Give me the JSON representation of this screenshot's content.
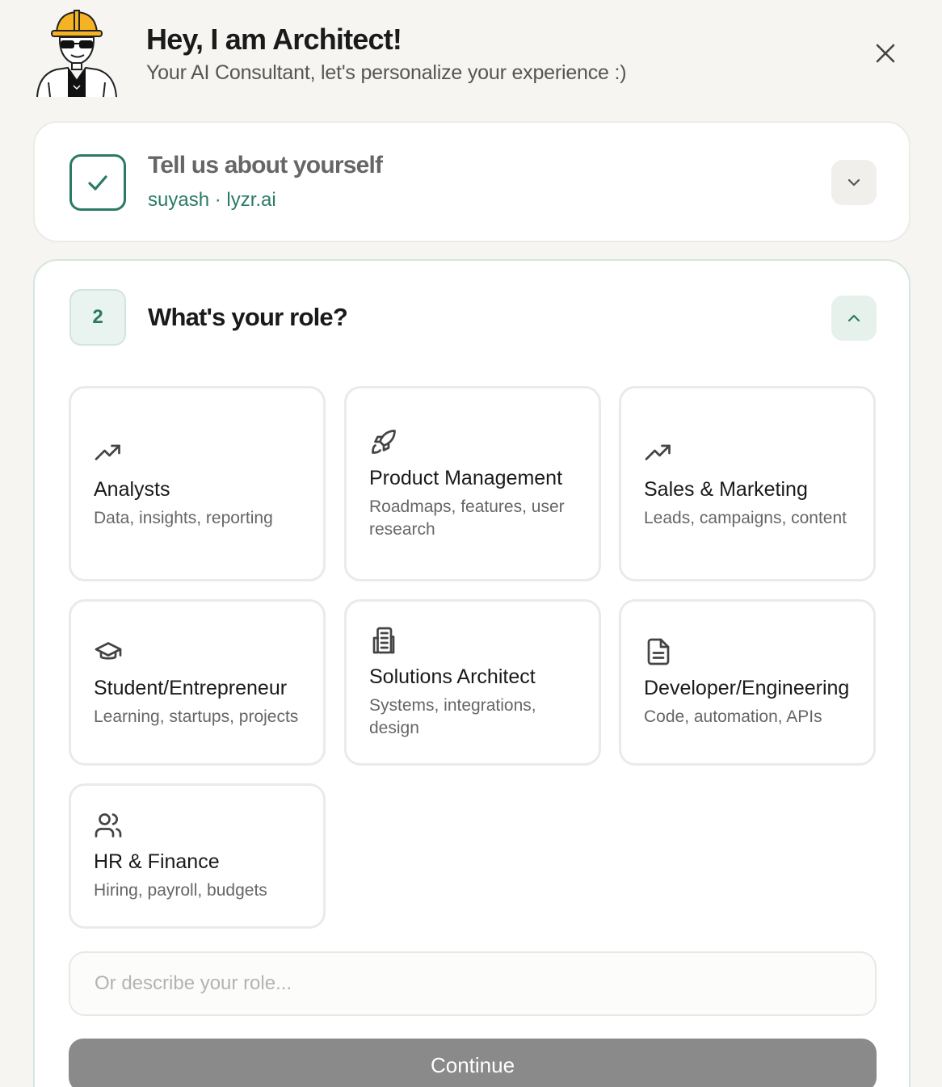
{
  "header": {
    "title": "Hey, I am Architect!",
    "subtitle": "Your AI Consultant, let's personalize your experience :)"
  },
  "step1": {
    "title": "Tell us about yourself",
    "subtitle": "suyash · lyzr.ai",
    "status_icon": "check-icon",
    "toggle_icon": "chevron-down-icon"
  },
  "step2": {
    "number": "2",
    "title": "What's your role?",
    "toggle_icon": "chevron-up-icon",
    "roles": [
      {
        "title": "Analysts",
        "desc": "Data, insights, reporting",
        "icon": "trending-up-icon"
      },
      {
        "title": "Product Management",
        "desc": "Roadmaps, features, user research",
        "icon": "rocket-icon"
      },
      {
        "title": "Sales & Marketing",
        "desc": "Leads, campaigns, content",
        "icon": "trending-up-icon"
      },
      {
        "title": "Student/Entrepreneur",
        "desc": "Learning, startups, projects",
        "icon": "graduation-cap-icon"
      },
      {
        "title": "Solutions Architect",
        "desc": "Systems, integrations, design",
        "icon": "building-icon"
      },
      {
        "title": "Developer/Engineering",
        "desc": "Code, automation, APIs",
        "icon": "file-text-icon"
      },
      {
        "title": "HR & Finance",
        "desc": "Hiring, payroll, budgets",
        "icon": "users-icon"
      }
    ],
    "input_placeholder": "Or describe your role...",
    "input_value": "",
    "continue_label": "Continue"
  },
  "colors": {
    "accent": "#2a7a66",
    "background": "#f6f5f2",
    "button_disabled": "#8a8a8a"
  }
}
